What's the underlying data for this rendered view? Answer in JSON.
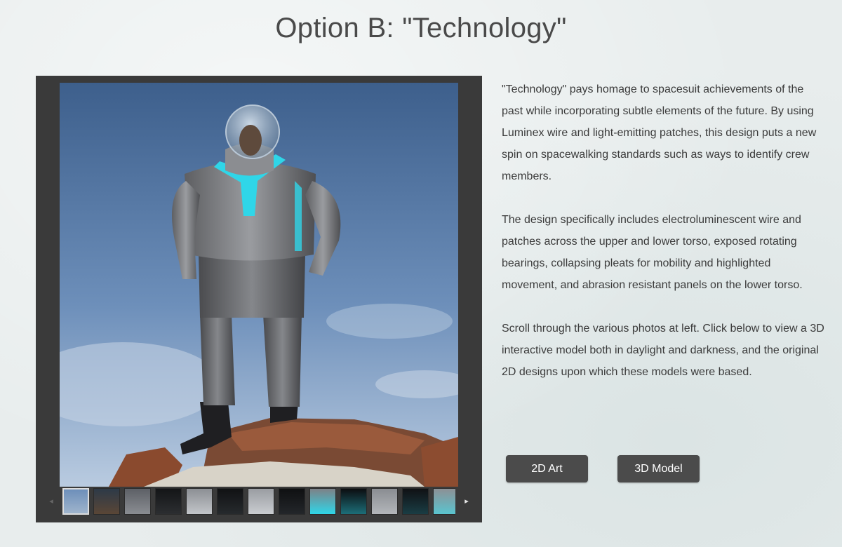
{
  "header": {
    "title": "Option B: \"Technology\""
  },
  "gallery": {
    "main_photo_alt": "Technology spacesuit standing on rock",
    "thumbnail_count": 13,
    "selected_index": 0,
    "prev_arrow": "◂",
    "next_arrow": "▸"
  },
  "description": {
    "paragraphs": [
      "\"Technology\" pays homage to spacesuit achievements of the past while incorporating subtle elements of the future. By using Luminex wire and light-emitting patches, this design puts a new spin on spacewalking standards such as ways to identify crew members.",
      "The design specifically includes electroluminescent wire and patches across the upper and lower torso, exposed rotating bearings, collapsing pleats for mobility and highlighted movement, and abrasion resistant panels on the lower torso.",
      "Scroll through the various photos at left. Click below to view a 3D interactive model both in daylight and darkness, and the original 2D designs upon which these models were based."
    ]
  },
  "actions": {
    "art_label": "2D Art",
    "model_label": "3D Model"
  },
  "colors": {
    "background": "#e8eded",
    "gallery_frame": "#3a3a3a",
    "button": "#4b4b4b",
    "suit_glow": "#2fd6e8"
  }
}
